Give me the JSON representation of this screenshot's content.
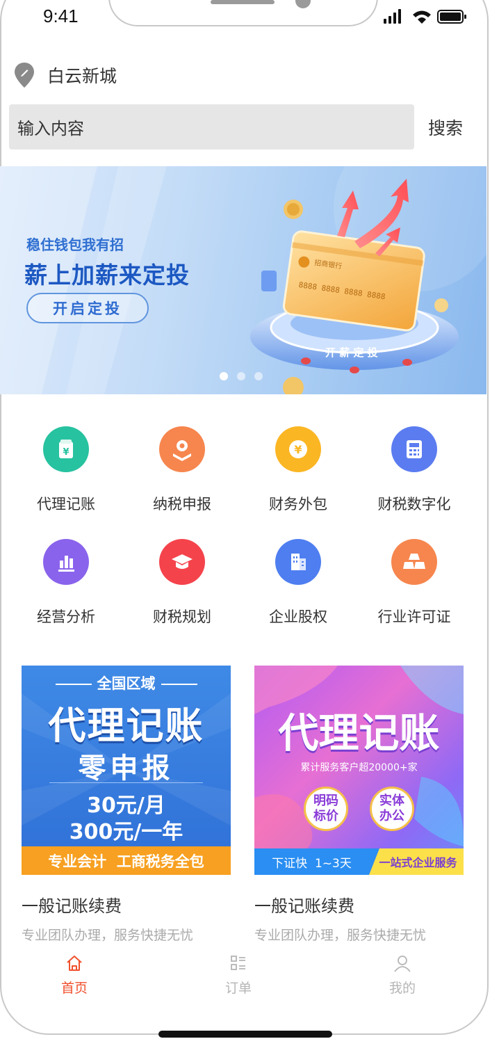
{
  "status_bar": {
    "time": "9:41"
  },
  "location": {
    "name": "白云新城",
    "icon": "location-pin-icon"
  },
  "search": {
    "placeholder": "输入内容",
    "button_label": "搜索"
  },
  "banner": {
    "subtitle": "稳住钱包我有招",
    "title": "薪上加薪来定投",
    "cta_label": "开启定投",
    "card_bank": "招商银行",
    "card_number": "8888 8888 8888 8888",
    "platform_label": "开 薪 定 投",
    "carousel": {
      "total": 3,
      "active": 1
    }
  },
  "services": [
    {
      "label": "代理记账",
      "icon": "bookkeeping-icon",
      "color": "#27c2a0"
    },
    {
      "label": "纳税申报",
      "icon": "tax-declare-icon",
      "color": "#f6864e"
    },
    {
      "label": "财务外包",
      "icon": "yuan-coin-icon",
      "color": "#fbb624"
    },
    {
      "label": "财税数字化",
      "icon": "calculator-icon",
      "color": "#5b7cf0"
    },
    {
      "label": "经营分析",
      "icon": "bar-chart-icon",
      "color": "#8a63ec"
    },
    {
      "label": "财税规划",
      "icon": "graduation-cap-icon",
      "color": "#f5434c"
    },
    {
      "label": "企业股权",
      "icon": "building-icon",
      "color": "#4e7ef0"
    },
    {
      "label": "行业许可证",
      "icon": "gold-bars-icon",
      "color": "#f6864e"
    }
  ],
  "products": [
    {
      "title": "一般记账续费",
      "desc": "专业团队办理，服务快捷无忧",
      "poster": {
        "top_label": "全国区域",
        "headline": "代理记账",
        "subhead": "零申报",
        "price_month": "30元/月",
        "price_year": "300元/一年",
        "footer": "专业会计  工商税务全包"
      }
    },
    {
      "title": "一般记账续费",
      "desc": "专业团队办理，服务快捷无忧",
      "poster": {
        "headline": "代理记账",
        "subline": "累计服务客户超20000+家",
        "badge1": [
          "明码",
          "标价"
        ],
        "badge2": [
          "实体",
          "办公"
        ],
        "footer_left": "下证快  1~3天",
        "footer_right": "一站式企业服务"
      }
    }
  ],
  "tabbar": {
    "active_color": "#f0502d",
    "items": [
      {
        "label": "首页",
        "icon": "home-icon",
        "active": true
      },
      {
        "label": "订单",
        "icon": "order-list-icon",
        "active": false
      },
      {
        "label": "我的",
        "icon": "user-icon",
        "active": false
      }
    ]
  }
}
